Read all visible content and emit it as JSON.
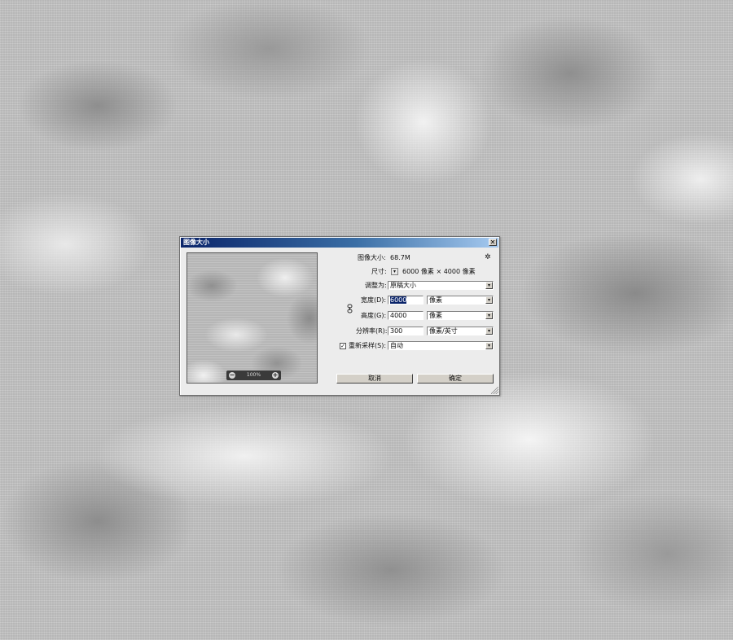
{
  "dialog": {
    "title": "图像大小",
    "close_glyph": "✕",
    "image_size_label": "图像大小:",
    "image_size_value": "68.7M",
    "gear_glyph": "✲",
    "dimension_label": "尺寸:",
    "dimension_value": "6000 像素  ×  4000 像素",
    "fit_label": "调整为:",
    "fit_value": "原稿大小",
    "width_label": "宽度(D):",
    "width_value": "6000",
    "width_unit": "像素",
    "height_label": "高度(G):",
    "height_value": "4000",
    "height_unit": "像素",
    "resolution_label": "分辨率(R):",
    "resolution_value": "300",
    "resolution_unit": "像素/英寸",
    "resample_label": "重新采样(S):",
    "resample_checked": true,
    "resample_check_glyph": "✓",
    "resample_value": "自动",
    "cancel_label": "取消",
    "ok_label": "确定"
  },
  "preview": {
    "zoom_text": "100%",
    "zoom_out_glyph": "−",
    "zoom_in_glyph": "+"
  },
  "icons": {
    "dropdown": "▾"
  }
}
